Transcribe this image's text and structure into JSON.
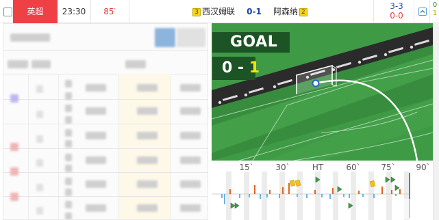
{
  "match": {
    "league": "英超",
    "time": "23:30",
    "minute": "85",
    "minute_mark": "′",
    "home_red_cards": "3",
    "home_team": "西汉姆联",
    "score": "0-1",
    "away_team": "阿森纳",
    "away_red_cards": "2",
    "half_score_1": "3-3",
    "half_score_2": "0-0",
    "extra_1": "0",
    "extra_2": "1"
  },
  "goal_animation": {
    "banner": "GOAL",
    "score_home": "0",
    "score_dash": "-",
    "score_away": "1"
  },
  "timeline": {
    "labels": [
      "15`",
      "30`",
      "HT",
      "60`",
      "75`",
      "90`"
    ]
  },
  "colors": {
    "league_bg": "#ef4046",
    "score_blue": "#1a3fb0",
    "minute_red": "#e4393c",
    "pitch_green": "#3f9a45",
    "banner_green": "#1d5425",
    "score_highlight": "#ffe400"
  },
  "icons": [
    "checkbox-icon",
    "expand-arrow-icon",
    "ball-icon",
    "yellow-card-icon",
    "flag-icon"
  ]
}
